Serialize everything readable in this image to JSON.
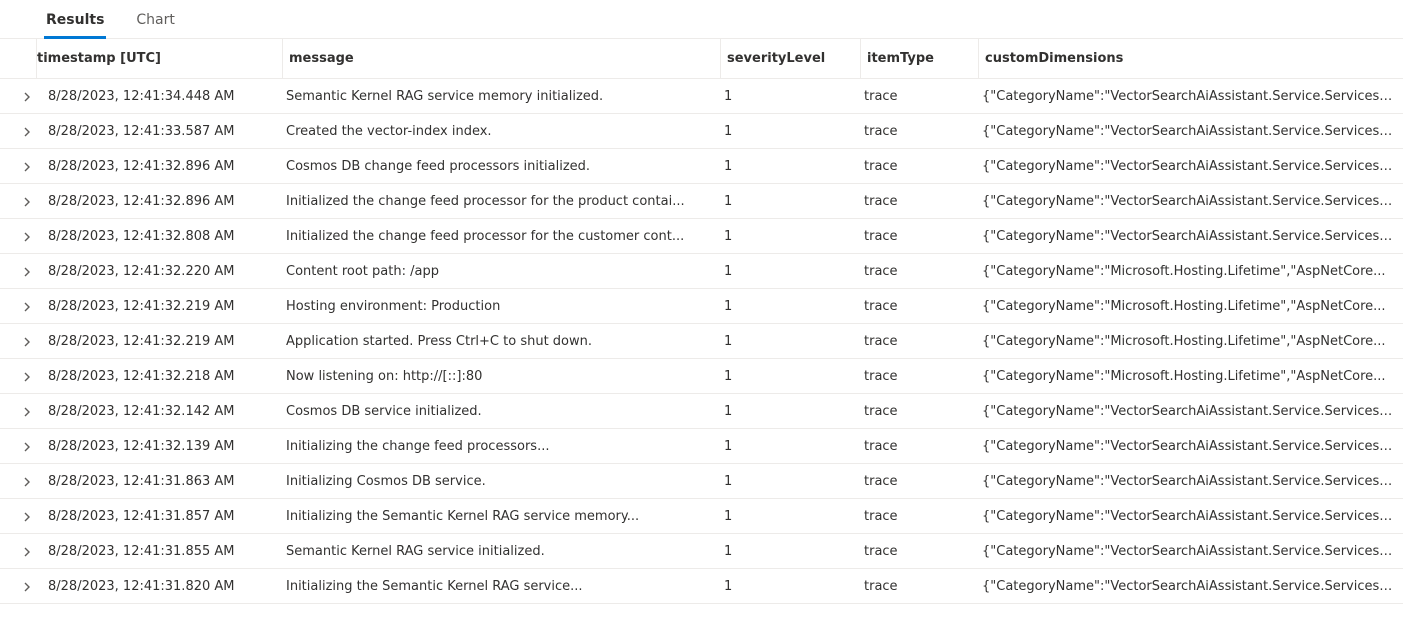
{
  "tabs": {
    "results": "Results",
    "chart": "Chart"
  },
  "columns": {
    "timestamp": "timestamp [UTC]",
    "message": "message",
    "severityLevel": "severityLevel",
    "itemType": "itemType",
    "customDimensions": "customDimensions"
  },
  "rows": [
    {
      "timestamp": "8/28/2023, 12:41:34.448 AM",
      "message": "Semantic Kernel RAG service memory initialized.",
      "severityLevel": "1",
      "itemType": "trace",
      "customDimensions": "{\"CategoryName\":\"VectorSearchAiAssistant.Service.Services...."
    },
    {
      "timestamp": "8/28/2023, 12:41:33.587 AM",
      "message": "Created the vector-index index.",
      "severityLevel": "1",
      "itemType": "trace",
      "customDimensions": "{\"CategoryName\":\"VectorSearchAiAssistant.Service.Services...."
    },
    {
      "timestamp": "8/28/2023, 12:41:32.896 AM",
      "message": "Cosmos DB change feed processors initialized.",
      "severityLevel": "1",
      "itemType": "trace",
      "customDimensions": "{\"CategoryName\":\"VectorSearchAiAssistant.Service.Services...."
    },
    {
      "timestamp": "8/28/2023, 12:41:32.896 AM",
      "message": "Initialized the change feed processor for the product contai...",
      "severityLevel": "1",
      "itemType": "trace",
      "customDimensions": "{\"CategoryName\":\"VectorSearchAiAssistant.Service.Services...."
    },
    {
      "timestamp": "8/28/2023, 12:41:32.808 AM",
      "message": "Initialized the change feed processor for the customer cont...",
      "severityLevel": "1",
      "itemType": "trace",
      "customDimensions": "{\"CategoryName\":\"VectorSearchAiAssistant.Service.Services...."
    },
    {
      "timestamp": "8/28/2023, 12:41:32.220 AM",
      "message": "Content root path: /app",
      "severityLevel": "1",
      "itemType": "trace",
      "customDimensions": "{\"CategoryName\":\"Microsoft.Hosting.Lifetime\",\"AspNetCore..."
    },
    {
      "timestamp": "8/28/2023, 12:41:32.219 AM",
      "message": "Hosting environment: Production",
      "severityLevel": "1",
      "itemType": "trace",
      "customDimensions": "{\"CategoryName\":\"Microsoft.Hosting.Lifetime\",\"AspNetCore..."
    },
    {
      "timestamp": "8/28/2023, 12:41:32.219 AM",
      "message": "Application started. Press Ctrl+C to shut down.",
      "severityLevel": "1",
      "itemType": "trace",
      "customDimensions": "{\"CategoryName\":\"Microsoft.Hosting.Lifetime\",\"AspNetCore..."
    },
    {
      "timestamp": "8/28/2023, 12:41:32.218 AM",
      "message": "Now listening on: http://[::]:80",
      "severityLevel": "1",
      "itemType": "trace",
      "customDimensions": "{\"CategoryName\":\"Microsoft.Hosting.Lifetime\",\"AspNetCore..."
    },
    {
      "timestamp": "8/28/2023, 12:41:32.142 AM",
      "message": "Cosmos DB service initialized.",
      "severityLevel": "1",
      "itemType": "trace",
      "customDimensions": "{\"CategoryName\":\"VectorSearchAiAssistant.Service.Services...."
    },
    {
      "timestamp": "8/28/2023, 12:41:32.139 AM",
      "message": "Initializing the change feed processors...",
      "severityLevel": "1",
      "itemType": "trace",
      "customDimensions": "{\"CategoryName\":\"VectorSearchAiAssistant.Service.Services...."
    },
    {
      "timestamp": "8/28/2023, 12:41:31.863 AM",
      "message": "Initializing Cosmos DB service.",
      "severityLevel": "1",
      "itemType": "trace",
      "customDimensions": "{\"CategoryName\":\"VectorSearchAiAssistant.Service.Services...."
    },
    {
      "timestamp": "8/28/2023, 12:41:31.857 AM",
      "message": "Initializing the Semantic Kernel RAG service memory...",
      "severityLevel": "1",
      "itemType": "trace",
      "customDimensions": "{\"CategoryName\":\"VectorSearchAiAssistant.Service.Services...."
    },
    {
      "timestamp": "8/28/2023, 12:41:31.855 AM",
      "message": "Semantic Kernel RAG service initialized.",
      "severityLevel": "1",
      "itemType": "trace",
      "customDimensions": "{\"CategoryName\":\"VectorSearchAiAssistant.Service.Services...."
    },
    {
      "timestamp": "8/28/2023, 12:41:31.820 AM",
      "message": "Initializing the Semantic Kernel RAG service...",
      "severityLevel": "1",
      "itemType": "trace",
      "customDimensions": "{\"CategoryName\":\"VectorSearchAiAssistant.Service.Services...."
    }
  ]
}
